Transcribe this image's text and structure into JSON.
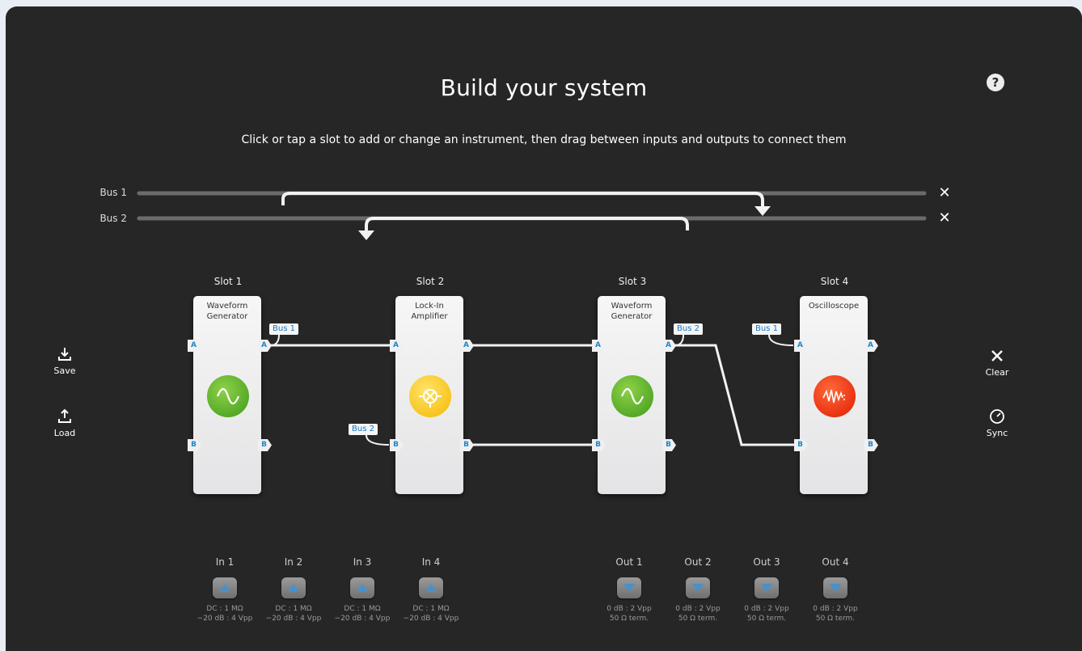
{
  "title": "Build your system",
  "help_label": "?",
  "subtitle": "Click or tap a slot to add or change an instrument, then drag between inputs and outputs to connect them",
  "buses": [
    {
      "label": "Bus 1",
      "close": "✕"
    },
    {
      "label": "Bus 2",
      "close": "✕"
    }
  ],
  "slots": [
    {
      "label": "Slot 1",
      "name_line1": "Waveform",
      "name_line2": "Generator",
      "icon": "sine-wave-icon",
      "color": "#4aae22"
    },
    {
      "label": "Slot 2",
      "name_line1": "Lock-In",
      "name_line2": "Amplifier",
      "icon": "lock-in-icon",
      "color": "#f6c200"
    },
    {
      "label": "Slot 3",
      "name_line1": "Waveform",
      "name_line2": "Generator",
      "icon": "sine-wave-icon",
      "color": "#4aae22"
    },
    {
      "label": "Slot 4",
      "name_line1": "Oscilloscope",
      "name_line2": "",
      "icon": "oscilloscope-icon",
      "color": "#f0320a"
    }
  ],
  "ports": {
    "a": "A",
    "b": "B"
  },
  "tags": {
    "slot1_out_a": "Bus 1",
    "slot2_in_b": "Bus 2",
    "slot3_out_a": "Bus 2",
    "slot4_in_a": "Bus 1"
  },
  "left_buttons": {
    "save": "Save",
    "load": "Load"
  },
  "right_buttons": {
    "clear": "Clear",
    "sync": "Sync"
  },
  "inputs": [
    {
      "label": "In 1",
      "line1": "DC : 1 MΩ",
      "line2": "−20 dB : 4 Vpp"
    },
    {
      "label": "In 2",
      "line1": "DC : 1 MΩ",
      "line2": "−20 dB : 4 Vpp"
    },
    {
      "label": "In 3",
      "line1": "DC : 1 MΩ",
      "line2": "−20 dB : 4 Vpp"
    },
    {
      "label": "In 4",
      "line1": "DC : 1 MΩ",
      "line2": "−20 dB : 4 Vpp"
    }
  ],
  "outputs": [
    {
      "label": "Out 1",
      "line1": "0 dB : 2 Vpp",
      "line2": "50 Ω term."
    },
    {
      "label": "Out 2",
      "line1": "0 dB : 2 Vpp",
      "line2": "50 Ω term."
    },
    {
      "label": "Out 3",
      "line1": "0 dB : 2 Vpp",
      "line2": "50 Ω term."
    },
    {
      "label": "Out 4",
      "line1": "0 dB : 2 Vpp",
      "line2": "50 Ω term."
    }
  ],
  "colors": {
    "panel": "#262626",
    "port_text": "#1e88c8",
    "tag_text": "#1976c6",
    "io_arrow": "#4a90c8"
  }
}
